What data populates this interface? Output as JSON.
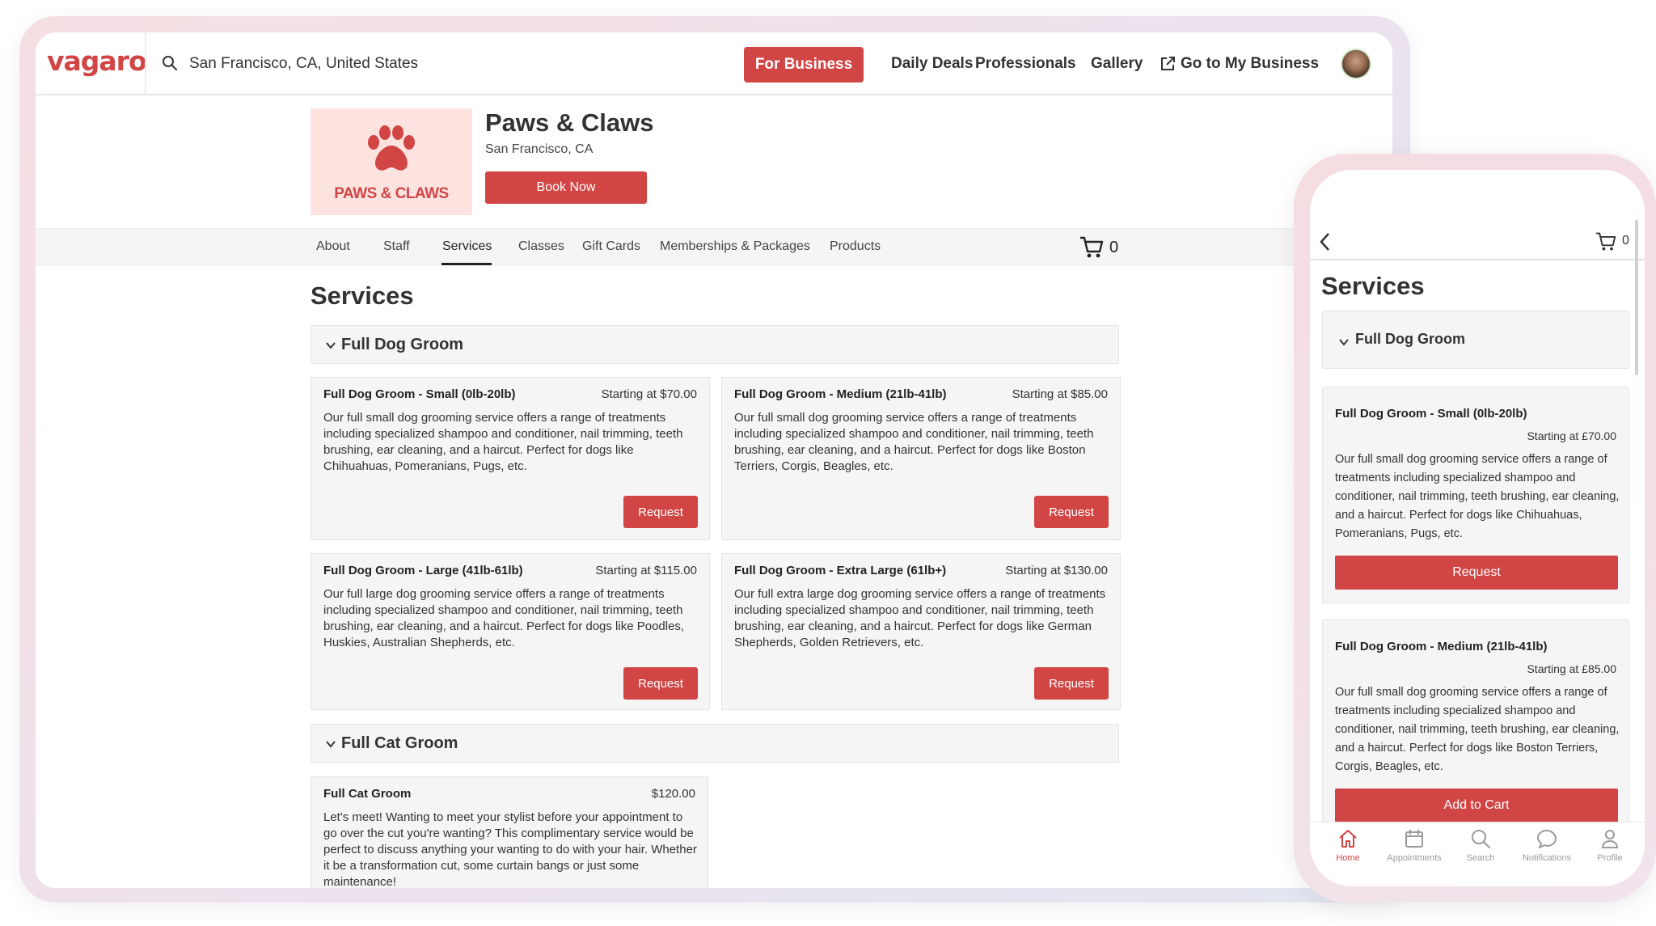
{
  "desktop": {
    "header": {
      "logo": "vagaro",
      "search_value": "San Francisco, CA, United States",
      "for_business": "For Business",
      "daily_deals": "Daily Deals",
      "professionals": "Professionals",
      "gallery": "Gallery",
      "go_to_business": "Go to My Business"
    },
    "business": {
      "logo_text": "PAWS & CLAWS",
      "name": "Paws & Claws",
      "location": "San Francisco, CA",
      "book_now": "Book Now"
    },
    "tabs": {
      "about": "About",
      "staff": "Staff",
      "services": "Services",
      "classes": "Classes",
      "gift_cards": "Gift Cards",
      "memberships": "Memberships & Packages",
      "products": "Products",
      "active": "Services",
      "cart_count": "0"
    },
    "services_title": "Services",
    "categories": [
      {
        "name": "Full Dog Groom",
        "items": [
          {
            "title": "Full Dog Groom - Small (0lb-20lb)",
            "price": "Starting at $70.00",
            "desc": "Our full small dog grooming service offers a range of treatments including specialized shampoo and conditioner, nail trimming, teeth brushing, ear cleaning, and a haircut. Perfect for dogs like Chihuahuas, Pomeranians, Pugs, etc.",
            "button": "Request"
          },
          {
            "title": "Full Dog Groom - Medium (21lb-41lb)",
            "price": "Starting at $85.00",
            "desc": "Our full small dog grooming service offers a range of treatments including specialized shampoo and conditioner, nail trimming, teeth brushing, ear cleaning, and a haircut. Perfect for dogs like Boston Terriers, Corgis, Beagles, etc.",
            "button": "Request"
          },
          {
            "title": "Full Dog Groom - Large (41lb-61lb)",
            "price": "Starting at $115.00",
            "desc": "Our full large dog grooming service offers a range of treatments including specialized shampoo and conditioner, nail trimming, teeth brushing, ear cleaning, and a haircut. Perfect for dogs like Poodles, Huskies, Australian Shepherds, etc.",
            "button": "Request"
          },
          {
            "title": "Full Dog Groom - Extra Large (61lb+)",
            "price": "Starting at $130.00",
            "desc": "Our full extra large dog grooming service offers a range of treatments including specialized shampoo and conditioner, nail trimming, teeth brushing, ear cleaning, and a haircut. Perfect for dogs like German Shepherds, Golden Retrievers, etc.",
            "button": "Request"
          }
        ]
      },
      {
        "name": "Full Cat Groom",
        "items": [
          {
            "title": "Full Cat Groom",
            "price": "$120.00",
            "desc": "Let's meet! Wanting to meet your stylist before your appointment to go over the cut you're wanting? This complimentary service would be perfect to discuss anything your wanting to do with your hair. Whether it be a transformation cut, some curtain bangs or just some maintenance!"
          }
        ]
      }
    ]
  },
  "mobile": {
    "cart_count": "0",
    "title": "Services",
    "category": "Full Dog Groom",
    "items": [
      {
        "title": "Full Dog Groom - Small (0lb-20lb)",
        "price": "Starting at £70.00",
        "desc": "Our full small dog grooming service offers a range of treatments including specialized shampoo and conditioner, nail trimming, teeth brushing, ear cleaning, and a haircut. Perfect for dogs like Chihuahuas, Pomeranians, Pugs, etc.",
        "button": "Request"
      },
      {
        "title": "Full Dog Groom - Medium (21lb-41lb)",
        "price": "Starting at £85.00",
        "desc": "Our full small dog grooming service offers a range of treatments including specialized shampoo and conditioner, nail trimming, teeth brushing, ear cleaning, and a haircut. Perfect for dogs like Boston Terriers, Corgis, Beagles, etc.",
        "button": "Add to Cart"
      }
    ],
    "tabbar": {
      "home": "Home",
      "appointments": "Appointments",
      "search": "Search",
      "notifications": "Notifications",
      "profile": "Profile",
      "active": "Home"
    }
  },
  "colors": {
    "accent": "#d14545",
    "panel": "#f5f5f5",
    "logo_bg": "#fde3e0"
  }
}
